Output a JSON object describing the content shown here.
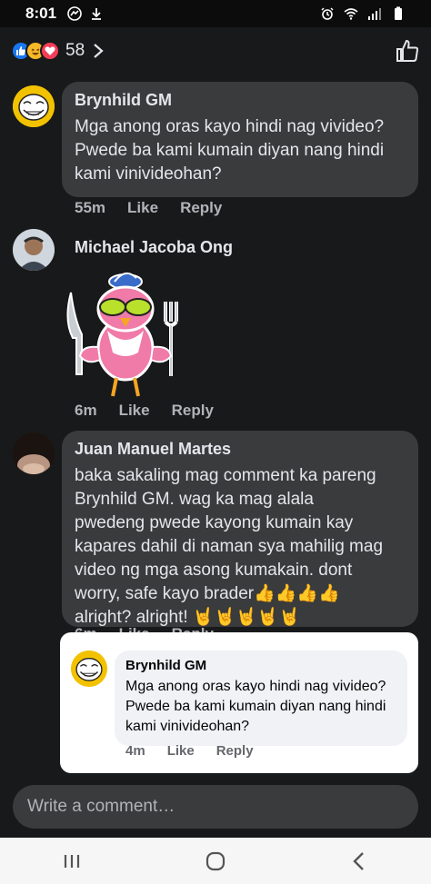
{
  "status_bar": {
    "time": "8:01"
  },
  "header": {
    "reaction_count": "58"
  },
  "comments": [
    {
      "author": "Brynhild GM",
      "lines": [
        "Mga anong oras kayo hindi nag vivideo?",
        "Pwede ba kami kumain diyan nang hindi",
        "kami vinivideohan?"
      ],
      "time": "55m",
      "like": "Like",
      "reply": "Reply"
    },
    {
      "author": "Michael Jacoba Ong",
      "time": "6m",
      "like": "Like",
      "reply": "Reply"
    },
    {
      "author": "Juan Manuel Martes",
      "lines": [
        "baka sakaling mag comment ka pareng",
        "Brynhild GM. wag ka mag alala",
        "pwedeng pwede kayong kumain kay",
        "kapares dahil di naman sya mahilig mag",
        "video ng mga asong kumakain. dont",
        "worry, safe kayo brader👍👍👍👍",
        "alright? alright! 🤘🤘🤘🤘🤘"
      ],
      "time": "6m",
      "like": "Like",
      "reply": "Reply"
    }
  ],
  "reply_preview": {
    "author": "Brynhild GM",
    "lines": [
      "Mga anong oras kayo hindi nag vivideo?",
      "Pwede ba kami kumain diyan nang hindi",
      "kami vinivideohan?"
    ],
    "time": "4m",
    "like": "Like",
    "reply": "Reply"
  },
  "composer": {
    "placeholder": "Write a comment…"
  }
}
